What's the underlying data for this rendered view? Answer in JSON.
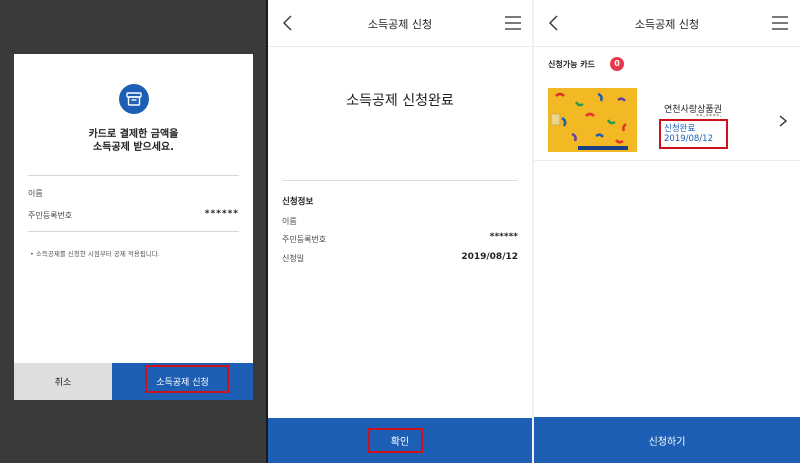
{
  "colors": {
    "primary": "#1d5fb4",
    "highlight": "#d0101a",
    "badge": "#e8394a",
    "card": "#f3b925"
  },
  "modal": {
    "icon": "receipt-box-icon",
    "title_line1": "카드로 결제한 금액을",
    "title_line2": "소득공제 받으세요.",
    "name_label": "이름",
    "id_label": "주민등록번호",
    "id_value": "******",
    "notice": "• 소득공제를 신청한 시점부터 공제 적용됩니다.",
    "cancel_label": "취소",
    "apply_label": "소득공제 신청"
  },
  "complete": {
    "header_title": "소득공제 신청",
    "title": "소득공제 신청완료",
    "section_title": "신청정보",
    "rows": [
      {
        "label": "이름",
        "value": ""
      },
      {
        "label": "주민등록번호",
        "value": "******"
      },
      {
        "label": "신청일",
        "value": "2019/08/12"
      }
    ],
    "confirm_label": "확인"
  },
  "cards": {
    "header_title": "소득공제 신청",
    "section_title": "신청가능 카드",
    "count": "0",
    "card_name": "연천사랑상품권",
    "card_mask": "**-****-",
    "status": "신청완료",
    "date": "2019/08/12",
    "apply_label": "신청하기"
  }
}
